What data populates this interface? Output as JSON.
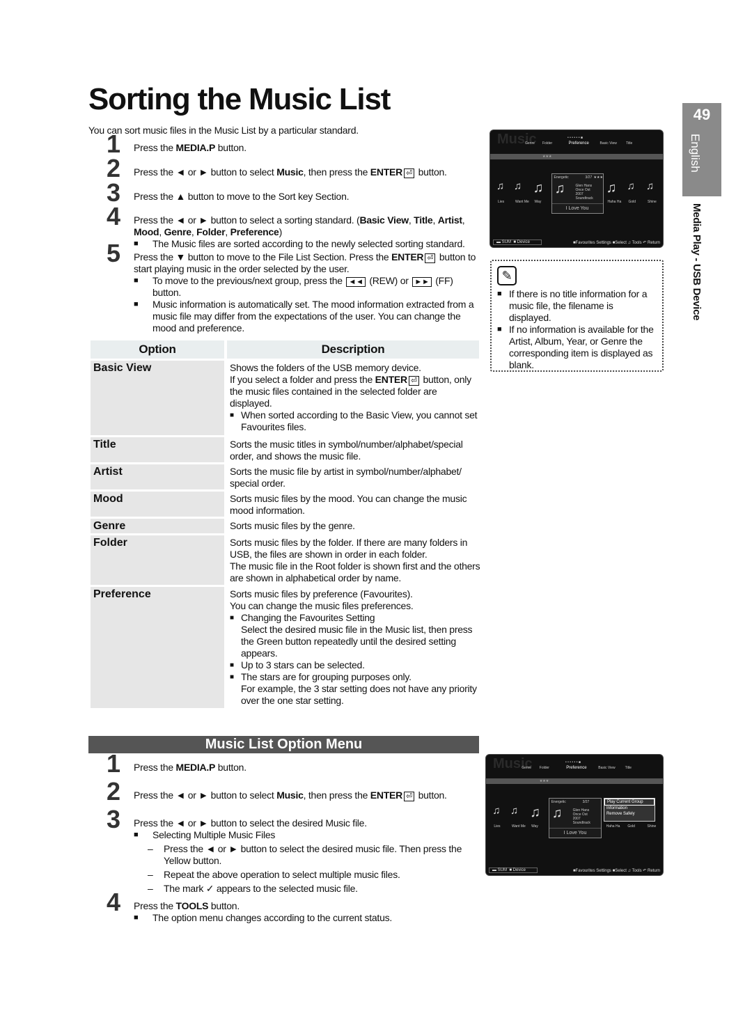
{
  "page": {
    "title": "Sorting the Music List",
    "intro": "You can sort music files in the Music List by a particular standard.",
    "page_number": "49",
    "language": "English",
    "section": "Media Play - USB Device"
  },
  "sort_steps": [
    {
      "num": "1",
      "runs": [
        [
          "Press the ",
          0
        ],
        [
          "MEDIA.P",
          1
        ],
        [
          " button.",
          0
        ]
      ]
    },
    {
      "num": "2",
      "runs": [
        [
          "Press the ◄ or ► button to select ",
          0
        ],
        [
          "Music",
          1
        ],
        [
          ", then press the ",
          0
        ],
        [
          "ENTER",
          1
        ],
        [
          "⏎",
          "i"
        ],
        [
          " button.",
          0
        ]
      ]
    },
    {
      "num": "3",
      "runs": [
        [
          "Press the ▲ button to move to the Sort key Section.",
          0
        ]
      ]
    },
    {
      "num": "4",
      "runs": [
        [
          "Press the ◄ or ► button to select a sorting standard. (",
          0
        ],
        [
          "Basic View",
          1
        ],
        [
          ", ",
          0
        ],
        [
          "Title",
          1
        ],
        [
          ", ",
          0
        ],
        [
          "Artist",
          1
        ],
        [
          ", ",
          0
        ],
        [
          "Mood",
          1
        ],
        [
          ", ",
          0
        ],
        [
          "Genre",
          1
        ],
        [
          ", ",
          0
        ],
        [
          "Folder",
          1
        ],
        [
          ", ",
          0
        ],
        [
          "Preference",
          1
        ],
        [
          ")",
          0
        ]
      ],
      "bullets": [
        [
          [
            "The Music files are sorted according to the newly selected sorting standard.",
            0
          ]
        ]
      ]
    },
    {
      "num": "5",
      "runs": [
        [
          "Press the ▼ button to move to the File List Section. Press the ",
          0
        ],
        [
          "ENTER",
          1
        ],
        [
          "⏎",
          "i"
        ],
        [
          " button to start playing music in the order selected by the user.",
          0
        ]
      ],
      "bullets": [
        [
          [
            "To move to the previous/next group, press the ",
            0
          ],
          [
            "◄◄",
            "i"
          ],
          [
            " (REW) or ",
            0
          ],
          [
            "►►",
            "i"
          ],
          [
            " (FF) button.",
            0
          ]
        ],
        [
          [
            "Music information is automatically set. The mood information extracted from a music file may differ from the expectations of the user. You can change the mood and preference.",
            0
          ]
        ]
      ]
    }
  ],
  "table": {
    "headers": [
      "Option",
      "Description"
    ],
    "rows": [
      {
        "option": "Basic View",
        "desc": [
          [
            [
              "Shows the folders of the USB memory device.",
              0
            ]
          ],
          [
            [
              "If you select a folder and press the ",
              0
            ],
            [
              "ENTER",
              1
            ],
            [
              "⏎",
              "i"
            ],
            [
              " button, only the music files contained in the selected folder are displayed.",
              0
            ]
          ]
        ],
        "bullets": [
          [
            [
              "When sorted according to the Basic View, you cannot set Favourites files.",
              0
            ]
          ]
        ]
      },
      {
        "option": "Title",
        "desc": [
          [
            [
              "Sorts the music titles in symbol/number/alphabet/special order, and shows the music file.",
              0
            ]
          ]
        ]
      },
      {
        "option": "Artist",
        "desc": [
          [
            [
              "Sorts the music file by artist in symbol/number/alphabet/ special order.",
              0
            ]
          ]
        ]
      },
      {
        "option": "Mood",
        "desc": [
          [
            [
              "Sorts music files by the mood. You can change the music mood information.",
              0
            ]
          ]
        ]
      },
      {
        "option": "Genre",
        "desc": [
          [
            [
              "Sorts music files by the genre.",
              0
            ]
          ]
        ]
      },
      {
        "option": "Folder",
        "desc": [
          [
            [
              "Sorts music files by the folder. If there are many folders in USB, the files are shown in order in each folder.",
              0
            ]
          ],
          [
            [
              "The music file in the Root folder is shown first and the others are shown in alphabetical order by name.",
              0
            ]
          ]
        ]
      },
      {
        "option": "Preference",
        "desc": [
          [
            [
              "Sorts music files by preference (Favourites).",
              0
            ]
          ],
          [
            [
              "You can change the music files preferences.",
              0
            ]
          ]
        ],
        "bullets": [
          [
            [
              "Changing the Favourites Setting",
              0
            ]
          ],
          [
            [
              "Select the desired music file in the Music list, then press the Green button repeatedly until the desired setting appears.",
              0
            ]
          ],
          [
            [
              "Up to 3 stars can be selected.",
              0
            ]
          ],
          [
            [
              "The stars are for grouping purposes only.",
              0
            ]
          ],
          [
            [
              "For example, the 3 star setting does not have any priority over the one star setting.",
              0
            ]
          ]
        ]
      }
    ]
  },
  "notes": [
    "If there is no title information for a music file, the filename is displayed.",
    "If no information is available for the Artist, Album, Year, or Genre the corresponding item is displayed as blank."
  ],
  "option_menu": {
    "title": "Music List Option Menu",
    "steps": [
      {
        "num": "1",
        "runs": [
          [
            "Press the ",
            0
          ],
          [
            "MEDIA.P",
            1
          ],
          [
            " button.",
            0
          ]
        ]
      },
      {
        "num": "2",
        "runs": [
          [
            "Press the ◄ or ► button to select ",
            0
          ],
          [
            "Music",
            1
          ],
          [
            ", then press the ",
            0
          ],
          [
            "ENTER",
            1
          ],
          [
            "⏎",
            "i"
          ],
          [
            " button.",
            0
          ]
        ]
      },
      {
        "num": "3",
        "runs": [
          [
            "Press the ◄ or ► button to select the desired Music file.",
            0
          ]
        ],
        "bullets": [
          [
            [
              "Selecting Multiple Music Files",
              0
            ]
          ]
        ],
        "dashes": [
          [
            [
              "Press the ◄ or ► button to select the desired music file. Then press the Yellow button.",
              0
            ]
          ],
          [
            [
              "Repeat the above operation to select multiple music files.",
              0
            ]
          ],
          [
            [
              "The mark ✓ appears to the selected music file.",
              0
            ]
          ]
        ]
      },
      {
        "num": "4",
        "runs": [
          [
            "Press the ",
            0
          ],
          [
            "TOOLS",
            1
          ],
          [
            " button.",
            0
          ]
        ],
        "bullets": [
          [
            [
              "The option menu changes according to the current status.",
              0
            ]
          ]
        ]
      }
    ]
  },
  "screens": [
    {
      "watermark": "Music",
      "sort_keys": [
        "Genre",
        "Folder",
        "Preference",
        "Basic View",
        "Title"
      ],
      "stars": "★★★",
      "songs": [
        "Lies",
        "Want Me",
        "Way",
        "Haha Ha",
        "Gold",
        "Shine"
      ],
      "card": {
        "mood": "Energetic",
        "count": "3/27",
        "rating": "★★★",
        "artist": "Glen Hans",
        "album": "Once Ost",
        "year": "2007",
        "genre": "Soundtrack",
        "title": "I Love You"
      },
      "footer": {
        "device": "SUM",
        "device_label": "Device",
        "hints": "■Favourites Settings ■Select ♫ Tools ↶ Return"
      }
    },
    {
      "watermark": "Music",
      "sort_keys": [
        "Genre",
        "Folder",
        "Preference",
        "Basic View",
        "Title"
      ],
      "stars": "★★★",
      "songs": [
        "Lies",
        "Want Me",
        "Way",
        "Haha Ha",
        "Gold",
        "Shine"
      ],
      "card": {
        "mood": "Energetic",
        "count": "3/27",
        "artist": "Glen Hans",
        "album": "Once Ost",
        "year": "2007",
        "genre": "Soundtrack",
        "title": "I Love You"
      },
      "menu": [
        "Play Current Group",
        "Information",
        "Remove Safely"
      ],
      "footer": {
        "device": "SUM",
        "device_label": "Device",
        "hints": "■Favourites Settings ■Select ♫ Tools ↶ Return"
      }
    }
  ]
}
